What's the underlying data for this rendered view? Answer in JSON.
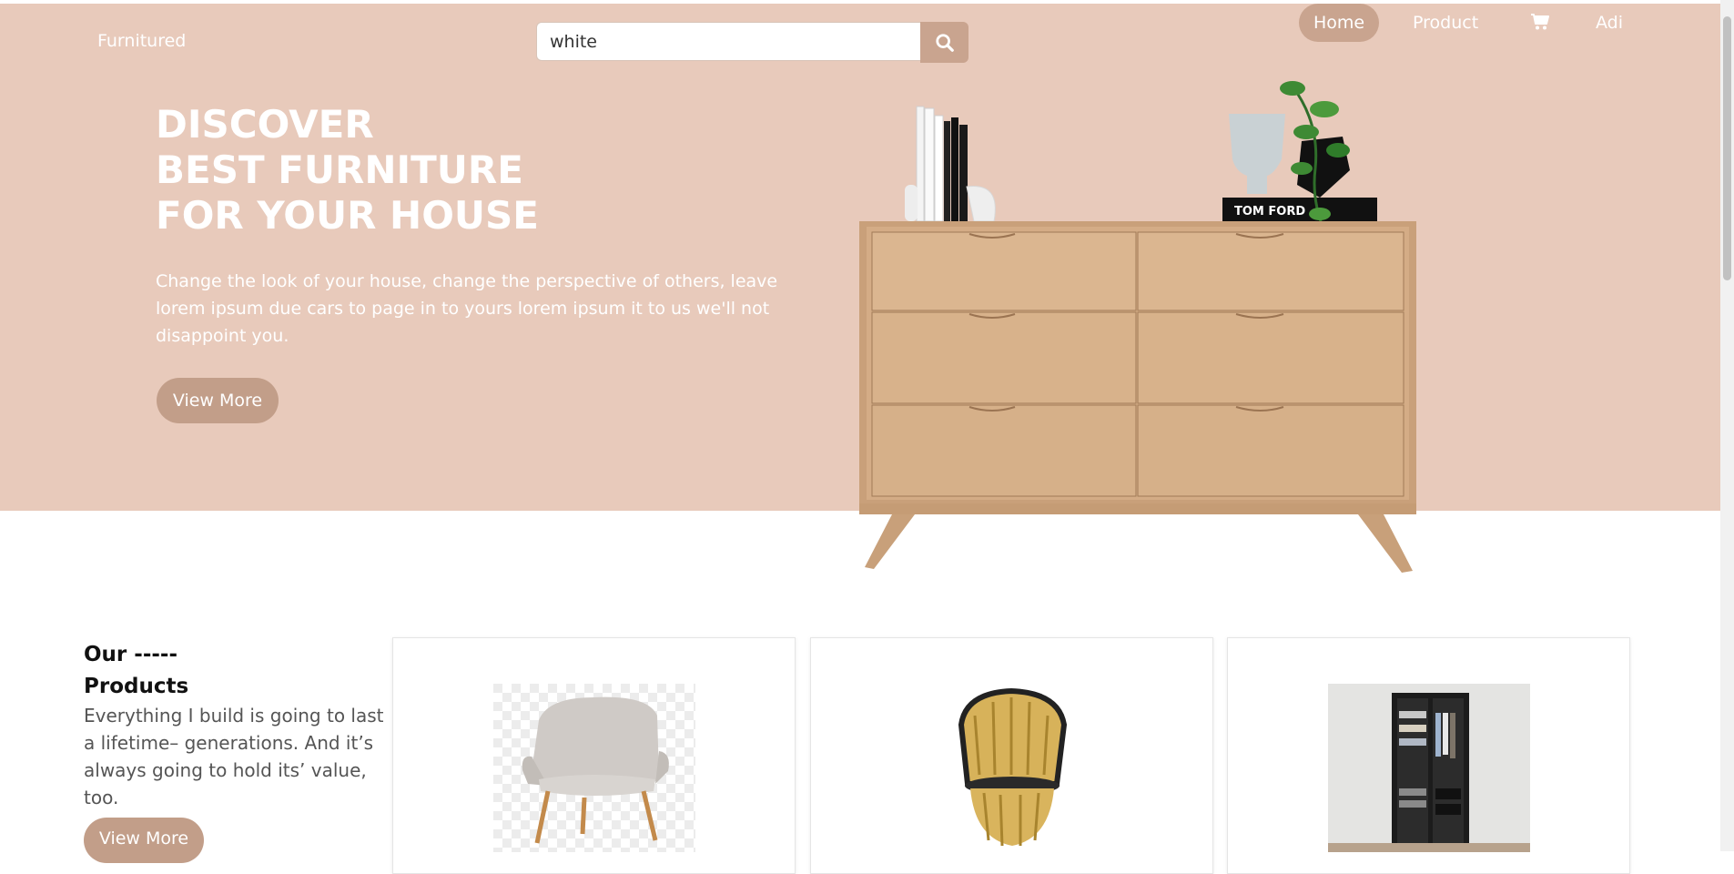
{
  "header": {
    "brand": "Furnitured",
    "search": {
      "value": "white",
      "placeholder": ""
    },
    "nav": {
      "home": "Home",
      "product": "Product",
      "user": "Adi"
    }
  },
  "hero": {
    "title_lines": [
      "DISCOVER",
      "BEST FURNITURE",
      "FOR YOUR HOUSE"
    ],
    "description": "Change the look of your house, change the perspective of others, leave lorem ipsum due cars to page in to yours lorem ipsum it to us we'll not disappoint you.",
    "button": "View More",
    "book_label": "TOM FORD"
  },
  "products": {
    "title_lines": [
      "Our -----",
      "Products"
    ],
    "description": "Everything I build is going to last a lifetime– generations. And it’s always going to hold its’ value, too.",
    "button": "View More",
    "cards": [
      {},
      {},
      {}
    ]
  },
  "colors": {
    "hero_bg": "#e8cabb",
    "accent": "#c9a48f",
    "button": "#c29e89",
    "text_light": "#ffffff",
    "text_dark": "#111111"
  }
}
